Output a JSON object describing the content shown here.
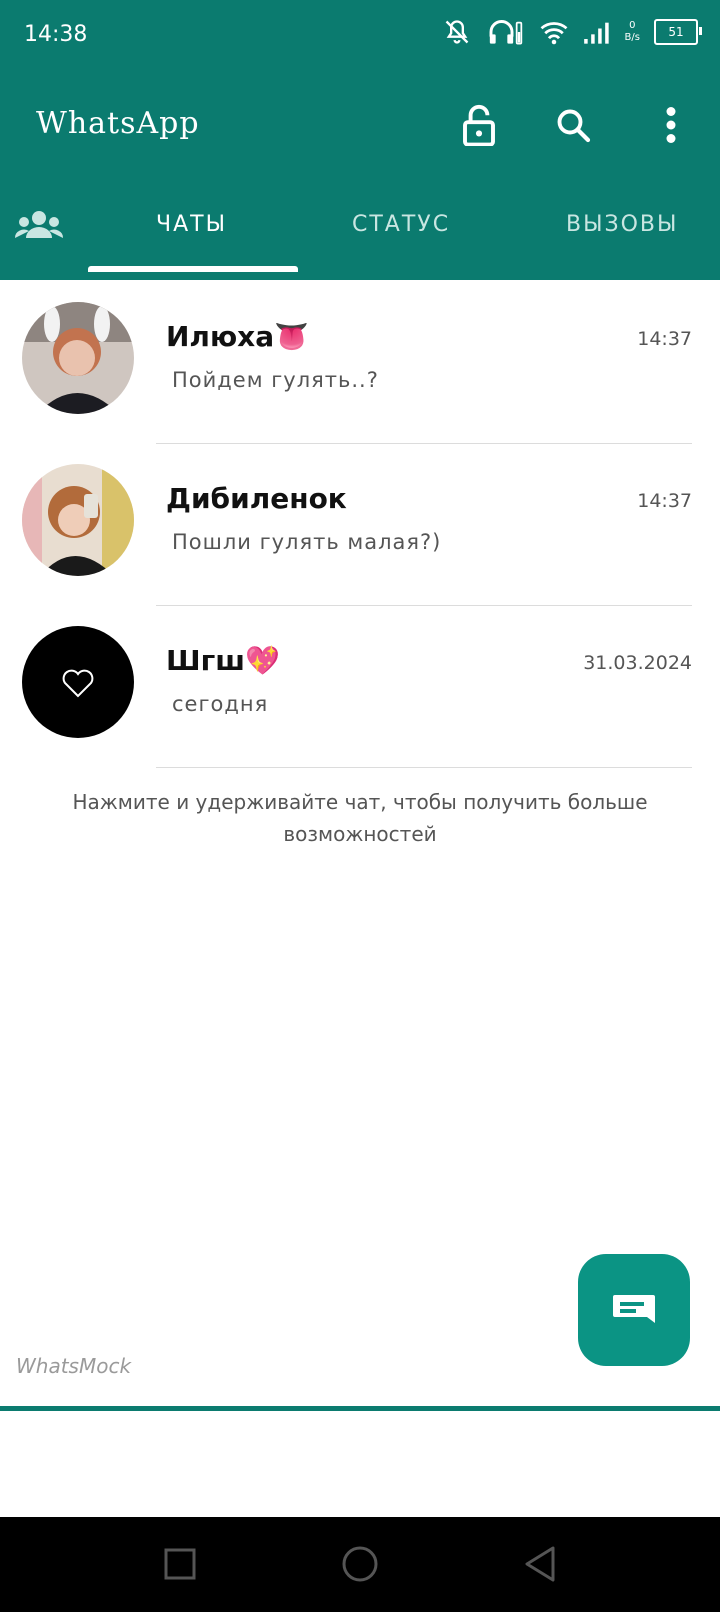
{
  "status_bar": {
    "time": "14:38",
    "net_speed_value": "0",
    "net_speed_unit": "B/s",
    "battery": "51"
  },
  "app_bar": {
    "title": "WhatsApp"
  },
  "tabs": [
    {
      "label": "ЧАТЫ",
      "active": true
    },
    {
      "label": "СТАТУС",
      "active": false
    },
    {
      "label": "ВЫЗОВЫ",
      "active": false
    }
  ],
  "chats": [
    {
      "name": "Илюха👅",
      "preview": "Пойдем гулять..?",
      "time": "14:37"
    },
    {
      "name": "Дибиленок",
      "preview": "Пошли гулять малая?)",
      "time": "14:37"
    },
    {
      "name": "Шгш💖",
      "preview": "сегодня",
      "time": "31.03.2024"
    }
  ],
  "hint": "Нажмите и удерживайте чат, чтобы получить больше возможностей",
  "watermark": "WhatsMock",
  "colors": {
    "primary": "#0b7b6f",
    "fab": "#0b9484",
    "background": "#ffffff"
  },
  "icons": [
    "lock-icon",
    "search-icon",
    "more-vert-icon",
    "community-icon",
    "new-chat-icon",
    "heart-icon",
    "recent-apps-icon",
    "home-icon",
    "back-icon"
  ]
}
